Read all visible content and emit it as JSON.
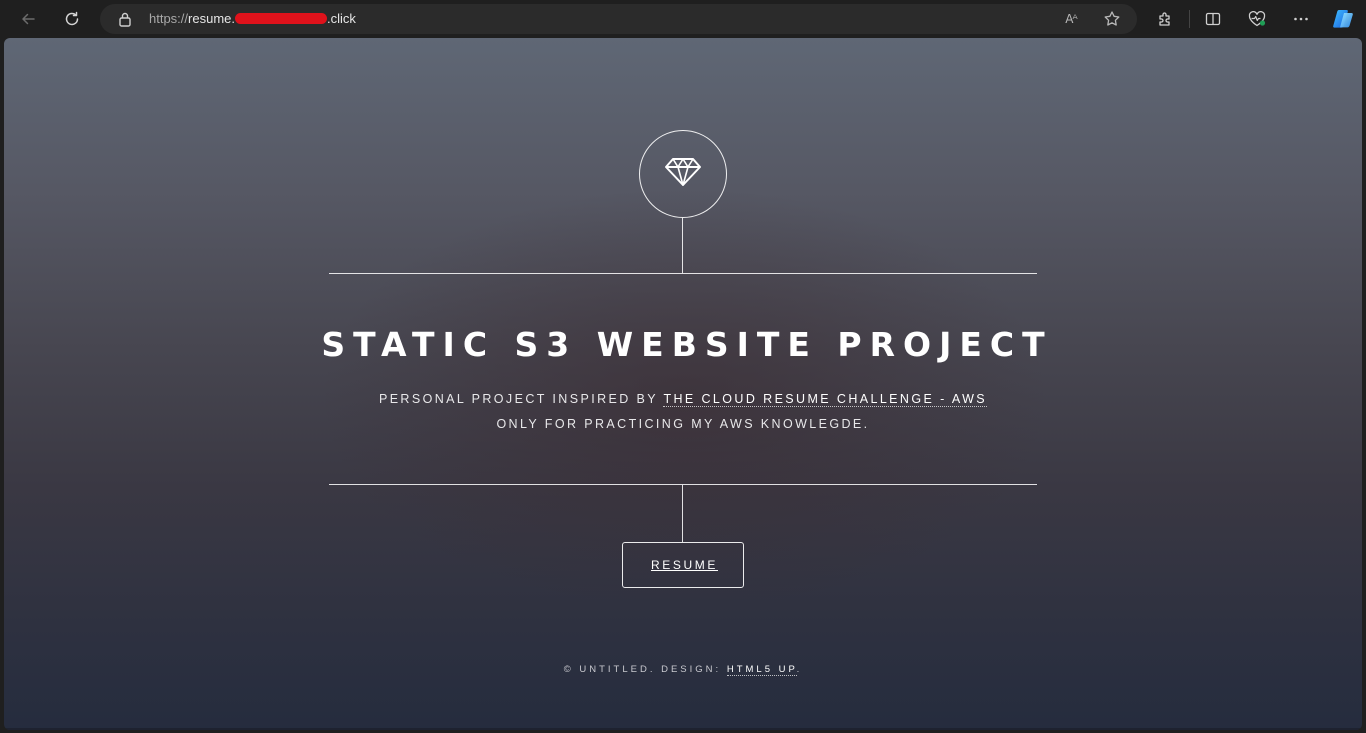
{
  "browser": {
    "url_scheme": "https://",
    "url_host_start": "resume.",
    "url_host_end": ".click",
    "icons": {
      "back": "arrow-left-icon",
      "refresh": "refresh-icon",
      "lock": "lock-icon",
      "read_aloud": "read-aloud-icon",
      "read_aloud_label": "Aᴬ",
      "favorite": "star-icon",
      "extensions": "puzzle-icon",
      "split_screen": "split-screen-icon",
      "browser_essentials": "heart-pulse-icon",
      "more": "more-icon",
      "copilot": "copilot-icon"
    }
  },
  "page": {
    "logo_icon": "diamond-icon",
    "title": "STATIC S3 WEBSITE PROJECT",
    "subtitle_line1_prefix": "PERSONAL PROJECT INSPIRED BY ",
    "subtitle_line1_link": "THE CLOUD RESUME CHALLENGE - AWS",
    "subtitle_line2": "ONLY FOR PRACTICING MY AWS KNOWLEGDE.",
    "button_label": "RESUME",
    "footer_prefix": "© UNTITLED. DESIGN: ",
    "footer_link": "HTML5 UP",
    "footer_suffix": "."
  },
  "colors": {
    "chrome_bg": "#1f1f1f",
    "address_bar_bg": "#2b2b2b",
    "redaction": "#e0121b",
    "page_text": "#ffffff"
  }
}
